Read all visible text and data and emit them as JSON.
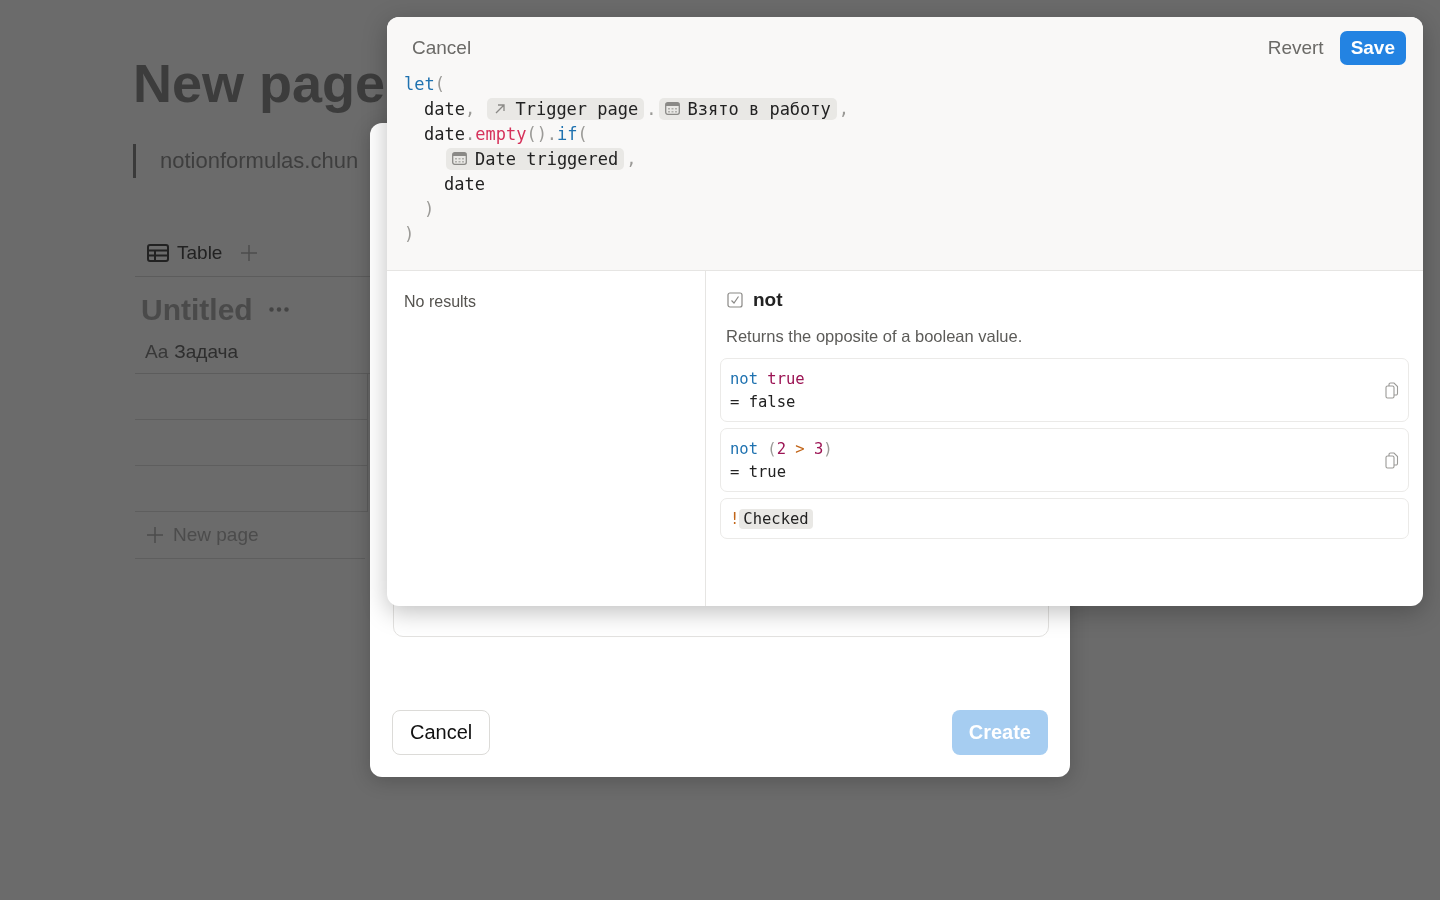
{
  "page": {
    "title": "New page",
    "quote": "notionformulas.chun",
    "view_tab": "Table",
    "database_title": "Untitled",
    "column_prefix": "Aa",
    "column": "Задача",
    "new_page": "New page"
  },
  "create_dialog": {
    "cancel": "Cancel",
    "create": {
      "label": "Create",
      "disabled": true
    }
  },
  "formula_editor": {
    "cancel": "Cancel",
    "revert": "Revert",
    "save": "Save",
    "code": [
      {
        "tokens": [
          {
            "kind": "kw",
            "text": "let"
          },
          {
            "kind": "punct",
            "text": "("
          }
        ],
        "children": [
          {
            "tokens": [
              {
                "kind": "id",
                "text": "date"
              },
              {
                "kind": "punct",
                "text": ", "
              },
              {
                "kind": "relation",
                "text": "Trigger page"
              },
              {
                "kind": "punct",
                "text": "."
              },
              {
                "kind": "date",
                "text": "Взято в работу"
              },
              {
                "kind": "punct",
                "text": ","
              }
            ]
          },
          {
            "tokens": [
              {
                "kind": "id",
                "text": "date"
              },
              {
                "kind": "punct",
                "text": "."
              },
              {
                "kind": "fn",
                "text": "empty"
              },
              {
                "kind": "punct",
                "text": "()."
              },
              {
                "kind": "kw",
                "text": "if"
              },
              {
                "kind": "punct",
                "text": "("
              }
            ],
            "children": [
              {
                "tokens": [
                  {
                    "kind": "date",
                    "text": "Date triggered"
                  },
                  {
                    "kind": "punct",
                    "text": ","
                  }
                ]
              },
              {
                "tokens": [
                  {
                    "kind": "id",
                    "text": "date"
                  }
                ]
              }
            ]
          },
          {
            "tokens": [
              {
                "kind": "punct",
                "text": ")"
              }
            ]
          }
        ]
      },
      {
        "tokens": [
          {
            "kind": "punct",
            "text": ")"
          }
        ]
      }
    ],
    "results": "No results",
    "doc": {
      "name": "not",
      "description": "Returns the opposite of a boolean value.",
      "examples": [
        {
          "copyable": true,
          "lines": [
            [
              {
                "kind": "kw",
                "text": "not"
              },
              {
                "kind": "val",
                "text": " true"
              }
            ],
            [
              {
                "kind": "id",
                "text": "= false"
              }
            ]
          ]
        },
        {
          "copyable": true,
          "lines": [
            [
              {
                "kind": "kw",
                "text": "not"
              },
              {
                "kind": "punct",
                "text": " ("
              },
              {
                "kind": "val",
                "text": "2"
              },
              {
                "kind": "op",
                "text": " > "
              },
              {
                "kind": "val",
                "text": "3"
              },
              {
                "kind": "punct",
                "text": ")"
              }
            ],
            [
              {
                "kind": "id",
                "text": "= true"
              }
            ]
          ]
        },
        {
          "copyable": false,
          "lines": [
            [
              {
                "kind": "op",
                "text": "!"
              },
              {
                "kind": "chip",
                "text": "Checked"
              }
            ]
          ]
        }
      ]
    }
  }
}
